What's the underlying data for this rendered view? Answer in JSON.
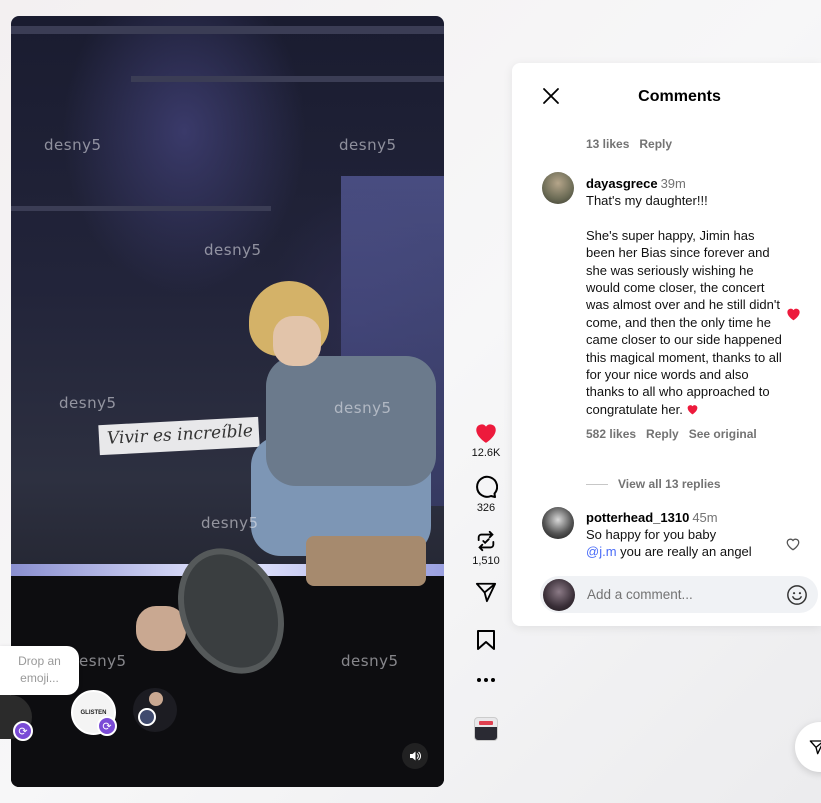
{
  "video": {
    "watermark": "desny5",
    "sign_text": "Vivir es increíble"
  },
  "overlay": {
    "emoji_drop": "Drop an emoji...",
    "avatar_label": "GLISTEN"
  },
  "rail": {
    "likes": "12.6K",
    "comments": "326",
    "reposts": "1,510"
  },
  "comments_panel": {
    "title": "Comments",
    "top_meta": {
      "likes": "13 likes",
      "reply": "Reply"
    },
    "comments": [
      {
        "username": "dayasgrece",
        "time": "39m",
        "line1": "That's my daughter!!!",
        "body": "She's super happy, Jimin has been her Bias since forever and she was seriously wishing he would come closer, the concert was almost over and he still didn't come, and then the only time he came closer to our side happened this magical moment, thanks to all for your nice words and also thanks to all who approached to congratulate her.",
        "likes": "582 likes",
        "reply": "Reply",
        "see_original": "See original",
        "liked": true
      },
      {
        "username": "potterhead_1310",
        "time": "45m",
        "line1": "So happy for you baby",
        "mention": "@j.m",
        "line2": " you are really an angel",
        "liked": false
      }
    ],
    "view_replies": "View all 13 replies",
    "add_placeholder": "Add a comment..."
  },
  "colors": {
    "like_red": "#ed1a3c",
    "mention_blue": "#4a6cf7",
    "muted_text": "#737373"
  }
}
